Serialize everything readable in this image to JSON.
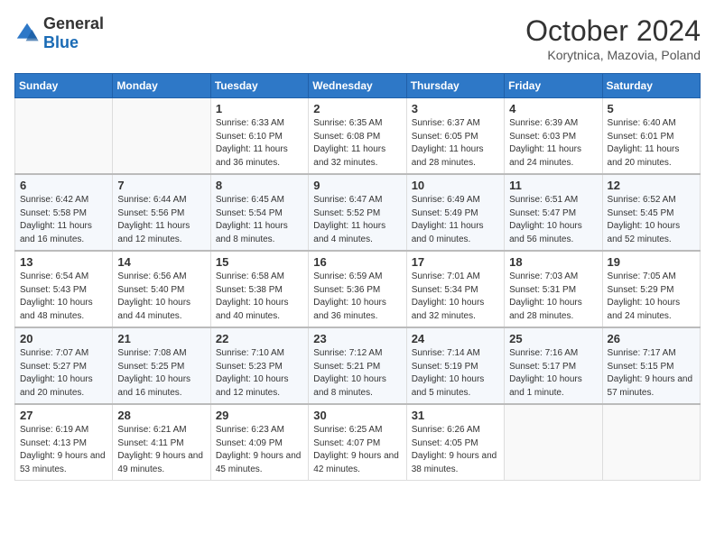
{
  "header": {
    "logo_general": "General",
    "logo_blue": "Blue",
    "month_year": "October 2024",
    "location": "Korytnica, Mazovia, Poland"
  },
  "days_of_week": [
    "Sunday",
    "Monday",
    "Tuesday",
    "Wednesday",
    "Thursday",
    "Friday",
    "Saturday"
  ],
  "weeks": [
    [
      {
        "day": "",
        "info": ""
      },
      {
        "day": "",
        "info": ""
      },
      {
        "day": "1",
        "info": "Sunrise: 6:33 AM\nSunset: 6:10 PM\nDaylight: 11 hours and 36 minutes."
      },
      {
        "day": "2",
        "info": "Sunrise: 6:35 AM\nSunset: 6:08 PM\nDaylight: 11 hours and 32 minutes."
      },
      {
        "day": "3",
        "info": "Sunrise: 6:37 AM\nSunset: 6:05 PM\nDaylight: 11 hours and 28 minutes."
      },
      {
        "day": "4",
        "info": "Sunrise: 6:39 AM\nSunset: 6:03 PM\nDaylight: 11 hours and 24 minutes."
      },
      {
        "day": "5",
        "info": "Sunrise: 6:40 AM\nSunset: 6:01 PM\nDaylight: 11 hours and 20 minutes."
      }
    ],
    [
      {
        "day": "6",
        "info": "Sunrise: 6:42 AM\nSunset: 5:58 PM\nDaylight: 11 hours and 16 minutes."
      },
      {
        "day": "7",
        "info": "Sunrise: 6:44 AM\nSunset: 5:56 PM\nDaylight: 11 hours and 12 minutes."
      },
      {
        "day": "8",
        "info": "Sunrise: 6:45 AM\nSunset: 5:54 PM\nDaylight: 11 hours and 8 minutes."
      },
      {
        "day": "9",
        "info": "Sunrise: 6:47 AM\nSunset: 5:52 PM\nDaylight: 11 hours and 4 minutes."
      },
      {
        "day": "10",
        "info": "Sunrise: 6:49 AM\nSunset: 5:49 PM\nDaylight: 11 hours and 0 minutes."
      },
      {
        "day": "11",
        "info": "Sunrise: 6:51 AM\nSunset: 5:47 PM\nDaylight: 10 hours and 56 minutes."
      },
      {
        "day": "12",
        "info": "Sunrise: 6:52 AM\nSunset: 5:45 PM\nDaylight: 10 hours and 52 minutes."
      }
    ],
    [
      {
        "day": "13",
        "info": "Sunrise: 6:54 AM\nSunset: 5:43 PM\nDaylight: 10 hours and 48 minutes."
      },
      {
        "day": "14",
        "info": "Sunrise: 6:56 AM\nSunset: 5:40 PM\nDaylight: 10 hours and 44 minutes."
      },
      {
        "day": "15",
        "info": "Sunrise: 6:58 AM\nSunset: 5:38 PM\nDaylight: 10 hours and 40 minutes."
      },
      {
        "day": "16",
        "info": "Sunrise: 6:59 AM\nSunset: 5:36 PM\nDaylight: 10 hours and 36 minutes."
      },
      {
        "day": "17",
        "info": "Sunrise: 7:01 AM\nSunset: 5:34 PM\nDaylight: 10 hours and 32 minutes."
      },
      {
        "day": "18",
        "info": "Sunrise: 7:03 AM\nSunset: 5:31 PM\nDaylight: 10 hours and 28 minutes."
      },
      {
        "day": "19",
        "info": "Sunrise: 7:05 AM\nSunset: 5:29 PM\nDaylight: 10 hours and 24 minutes."
      }
    ],
    [
      {
        "day": "20",
        "info": "Sunrise: 7:07 AM\nSunset: 5:27 PM\nDaylight: 10 hours and 20 minutes."
      },
      {
        "day": "21",
        "info": "Sunrise: 7:08 AM\nSunset: 5:25 PM\nDaylight: 10 hours and 16 minutes."
      },
      {
        "day": "22",
        "info": "Sunrise: 7:10 AM\nSunset: 5:23 PM\nDaylight: 10 hours and 12 minutes."
      },
      {
        "day": "23",
        "info": "Sunrise: 7:12 AM\nSunset: 5:21 PM\nDaylight: 10 hours and 8 minutes."
      },
      {
        "day": "24",
        "info": "Sunrise: 7:14 AM\nSunset: 5:19 PM\nDaylight: 10 hours and 5 minutes."
      },
      {
        "day": "25",
        "info": "Sunrise: 7:16 AM\nSunset: 5:17 PM\nDaylight: 10 hours and 1 minute."
      },
      {
        "day": "26",
        "info": "Sunrise: 7:17 AM\nSunset: 5:15 PM\nDaylight: 9 hours and 57 minutes."
      }
    ],
    [
      {
        "day": "27",
        "info": "Sunrise: 6:19 AM\nSunset: 4:13 PM\nDaylight: 9 hours and 53 minutes."
      },
      {
        "day": "28",
        "info": "Sunrise: 6:21 AM\nSunset: 4:11 PM\nDaylight: 9 hours and 49 minutes."
      },
      {
        "day": "29",
        "info": "Sunrise: 6:23 AM\nSunset: 4:09 PM\nDaylight: 9 hours and 45 minutes."
      },
      {
        "day": "30",
        "info": "Sunrise: 6:25 AM\nSunset: 4:07 PM\nDaylight: 9 hours and 42 minutes."
      },
      {
        "day": "31",
        "info": "Sunrise: 6:26 AM\nSunset: 4:05 PM\nDaylight: 9 hours and 38 minutes."
      },
      {
        "day": "",
        "info": ""
      },
      {
        "day": "",
        "info": ""
      }
    ]
  ]
}
